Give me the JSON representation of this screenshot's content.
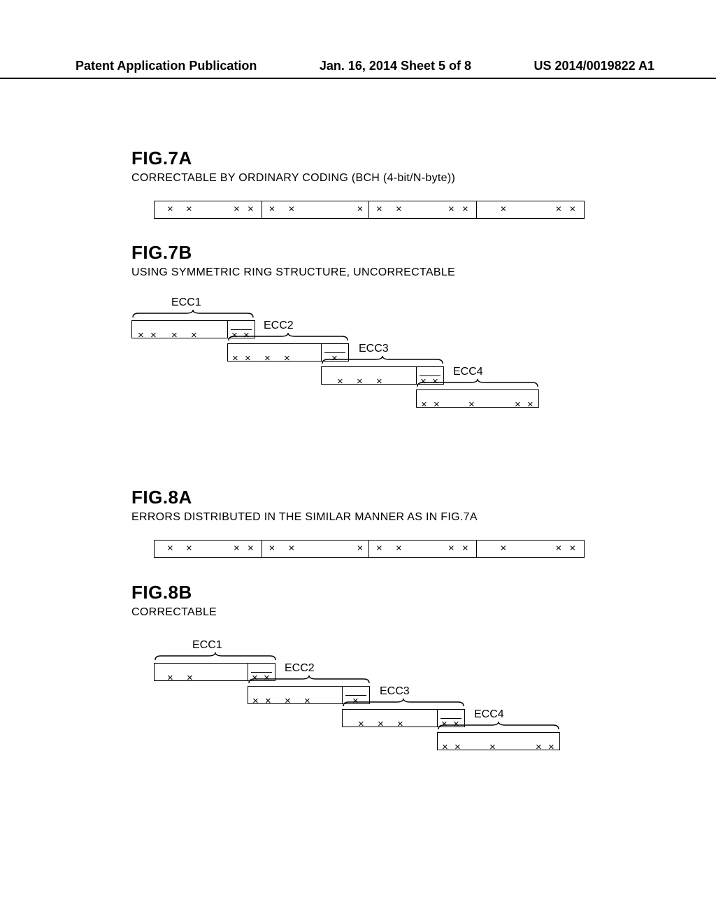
{
  "header": {
    "left": "Patent Application Publication",
    "mid": "Jan. 16, 2014  Sheet 5 of 8",
    "right": "US 2014/0019822 A1"
  },
  "figures": {
    "7A": {
      "title": "FIG.7A",
      "subtitle": "CORRECTABLE BY ORDINARY CODING (BCH (4-bit/N-byte))"
    },
    "7B": {
      "title": "FIG.7B",
      "subtitle": "USING SYMMETRIC RING STRUCTURE, UNCORRECTABLE"
    },
    "8A": {
      "title": "FIG.8A",
      "subtitle": "ERRORS DISTRIBUTED IN THE SIMILAR MANNER AS IN FIG.7A"
    },
    "8B": {
      "title": "FIG.8B",
      "subtitle": "CORRECTABLE"
    }
  },
  "mark": "×",
  "mark2": "× ×",
  "ecc": {
    "1": "ECC1",
    "2": "ECC2",
    "3": "ECC3",
    "4": "ECC4"
  }
}
